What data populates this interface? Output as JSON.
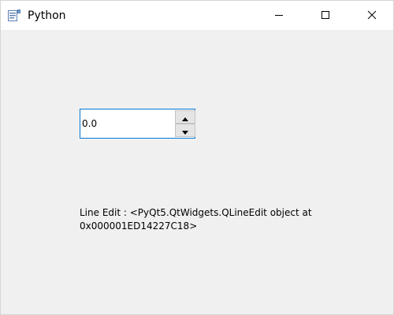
{
  "window": {
    "title": "Python",
    "app_icon": "python-app-icon",
    "controls": {
      "minimize_icon": "minimize-icon",
      "maximize_icon": "maximize-icon",
      "close_icon": "close-icon"
    }
  },
  "spinbox": {
    "value": "0.0",
    "up_icon": "arrow-up-icon",
    "down_icon": "arrow-down-icon",
    "focus_color": "#0078d7"
  },
  "label": {
    "text": "Line Edit : <PyQt5.QtWidgets.QLineEdit object at\n0x000001ED14227C18>"
  }
}
